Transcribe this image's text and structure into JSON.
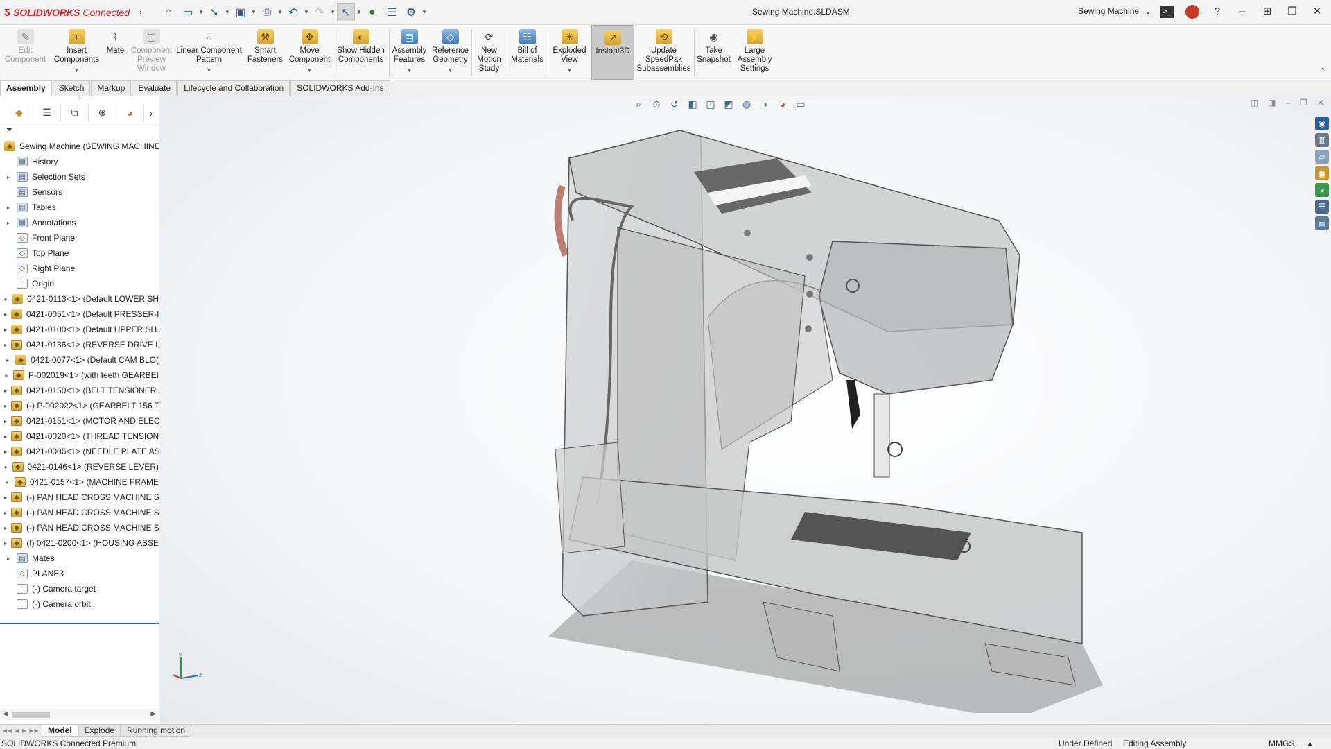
{
  "app": {
    "brand": "SOLIDWORKS",
    "brand_suffix": "Connected",
    "doc_title": "Sewing Machine.SLDASM",
    "config_name": "Sewing Machine"
  },
  "colors": {
    "brand_red": "#d61f26",
    "selection_blue": "#2b6cb0"
  },
  "ribbon": [
    {
      "label": "Edit Component",
      "icon": "edit-component-icon",
      "disabled": true
    },
    {
      "label": "Insert Components",
      "icon": "insert-components-icon"
    },
    {
      "label": "Mate",
      "icon": "paperclip-icon"
    },
    {
      "label": "Component Preview Window",
      "icon": "preview-window-icon",
      "disabled": true
    },
    {
      "label": "Linear Component Pattern",
      "icon": "pattern-icon"
    },
    {
      "label": "Smart Fasteners",
      "icon": "fastener-icon"
    },
    {
      "label": "Move Component",
      "icon": "move-component-icon"
    },
    {
      "label": "Show Hidden Components",
      "icon": "show-hidden-icon"
    },
    {
      "label": "Assembly Features",
      "icon": "assembly-features-icon"
    },
    {
      "label": "Reference Geometry",
      "icon": "reference-geometry-icon"
    },
    {
      "label": "New Motion Study",
      "icon": "motion-study-icon"
    },
    {
      "label": "Bill of Materials",
      "icon": "bom-icon"
    },
    {
      "label": "Exploded View",
      "icon": "exploded-view-icon"
    },
    {
      "label": "Instant3D",
      "icon": "instant3d-icon",
      "active": true
    },
    {
      "label": "Update SpeedPak Subassemblies",
      "icon": "speedpak-icon"
    },
    {
      "label": "Take Snapshot",
      "icon": "camera-icon"
    },
    {
      "label": "Large Assembly Settings",
      "icon": "large-assembly-icon"
    }
  ],
  "command_tabs": [
    "Assembly",
    "Sketch",
    "Markup",
    "Evaluate",
    "Lifecycle and Collaboration",
    "SOLIDWORKS Add-Ins"
  ],
  "tree": [
    {
      "label": "Sewing Machine  (SEWING MACHINE)",
      "kind": "asm",
      "exp": false,
      "root": true
    },
    {
      "label": "History",
      "kind": "fold",
      "exp": false
    },
    {
      "label": "Selection Sets",
      "kind": "fold",
      "exp": true
    },
    {
      "label": "Sensors",
      "kind": "fold",
      "exp": false
    },
    {
      "label": "Tables",
      "kind": "fold",
      "exp": true
    },
    {
      "label": "Annotations",
      "kind": "fold",
      "exp": true
    },
    {
      "label": "Front Plane",
      "kind": "plane",
      "exp": false
    },
    {
      "label": "Top Plane",
      "kind": "plane",
      "exp": false
    },
    {
      "label": "Right Plane",
      "kind": "plane",
      "exp": false
    },
    {
      "label": "Origin",
      "kind": "plain",
      "exp": false
    },
    {
      "label": "0421-0113<1> (Default LOWER SH",
      "kind": "asm",
      "exp": true
    },
    {
      "label": "0421-0051<1> (Default PRESSER-I",
      "kind": "asm",
      "exp": true
    },
    {
      "label": "0421-0100<1> (Default UPPER SH.",
      "kind": "asm",
      "exp": true
    },
    {
      "label": "0421-0136<1> (REVERSE DRIVE LII",
      "kind": "part",
      "exp": true
    },
    {
      "label": "0421-0077<1> (Default CAM BLO(",
      "kind": "asm",
      "exp": true
    },
    {
      "label": "P-002019<1> (with teeth GEARBEI",
      "kind": "part",
      "exp": true
    },
    {
      "label": "0421-0150<1> (BELT TENSIONER A",
      "kind": "part",
      "exp": true
    },
    {
      "label": "(-) P-002022<1> (GEARBELT 156 T",
      "kind": "part",
      "exp": true
    },
    {
      "label": "0421-0151<1> (MOTOR AND ELEC",
      "kind": "part",
      "exp": true
    },
    {
      "label": "0421-0020<1> (THREAD TENSION",
      "kind": "part",
      "exp": true
    },
    {
      "label": "0421-0006<1> (NEEDLE PLATE AS",
      "kind": "part",
      "exp": true
    },
    {
      "label": "0421-0146<1> (REVERSE LEVER)",
      "kind": "part",
      "exp": true
    },
    {
      "label": "0421-0157<1> (MACHINE FRAME",
      "kind": "part",
      "exp": true
    },
    {
      "label": "(-) PAN HEAD CROSS MACHINE S",
      "kind": "part",
      "exp": true
    },
    {
      "label": "(-) PAN HEAD CROSS MACHINE S",
      "kind": "part",
      "exp": true
    },
    {
      "label": "(-) PAN HEAD CROSS MACHINE S",
      "kind": "part",
      "exp": true
    },
    {
      "label": "(f) 0421-0200<1> (HOUSING ASSE",
      "kind": "part",
      "exp": true
    },
    {
      "label": "Mates",
      "kind": "fold",
      "exp": true
    },
    {
      "label": "PLANE3",
      "kind": "plane",
      "exp": false
    },
    {
      "label": "(-) Camera target",
      "kind": "plain",
      "exp": false
    },
    {
      "label": "(-) Camera orbit",
      "kind": "plain",
      "exp": false
    }
  ],
  "bottom_tabs": [
    "Model",
    "Explode",
    "Running motion"
  ],
  "status": {
    "product": "SOLIDWORKS Connected Premium",
    "definition": "Under Defined",
    "mode": "Editing Assembly",
    "units": "MMGS"
  }
}
